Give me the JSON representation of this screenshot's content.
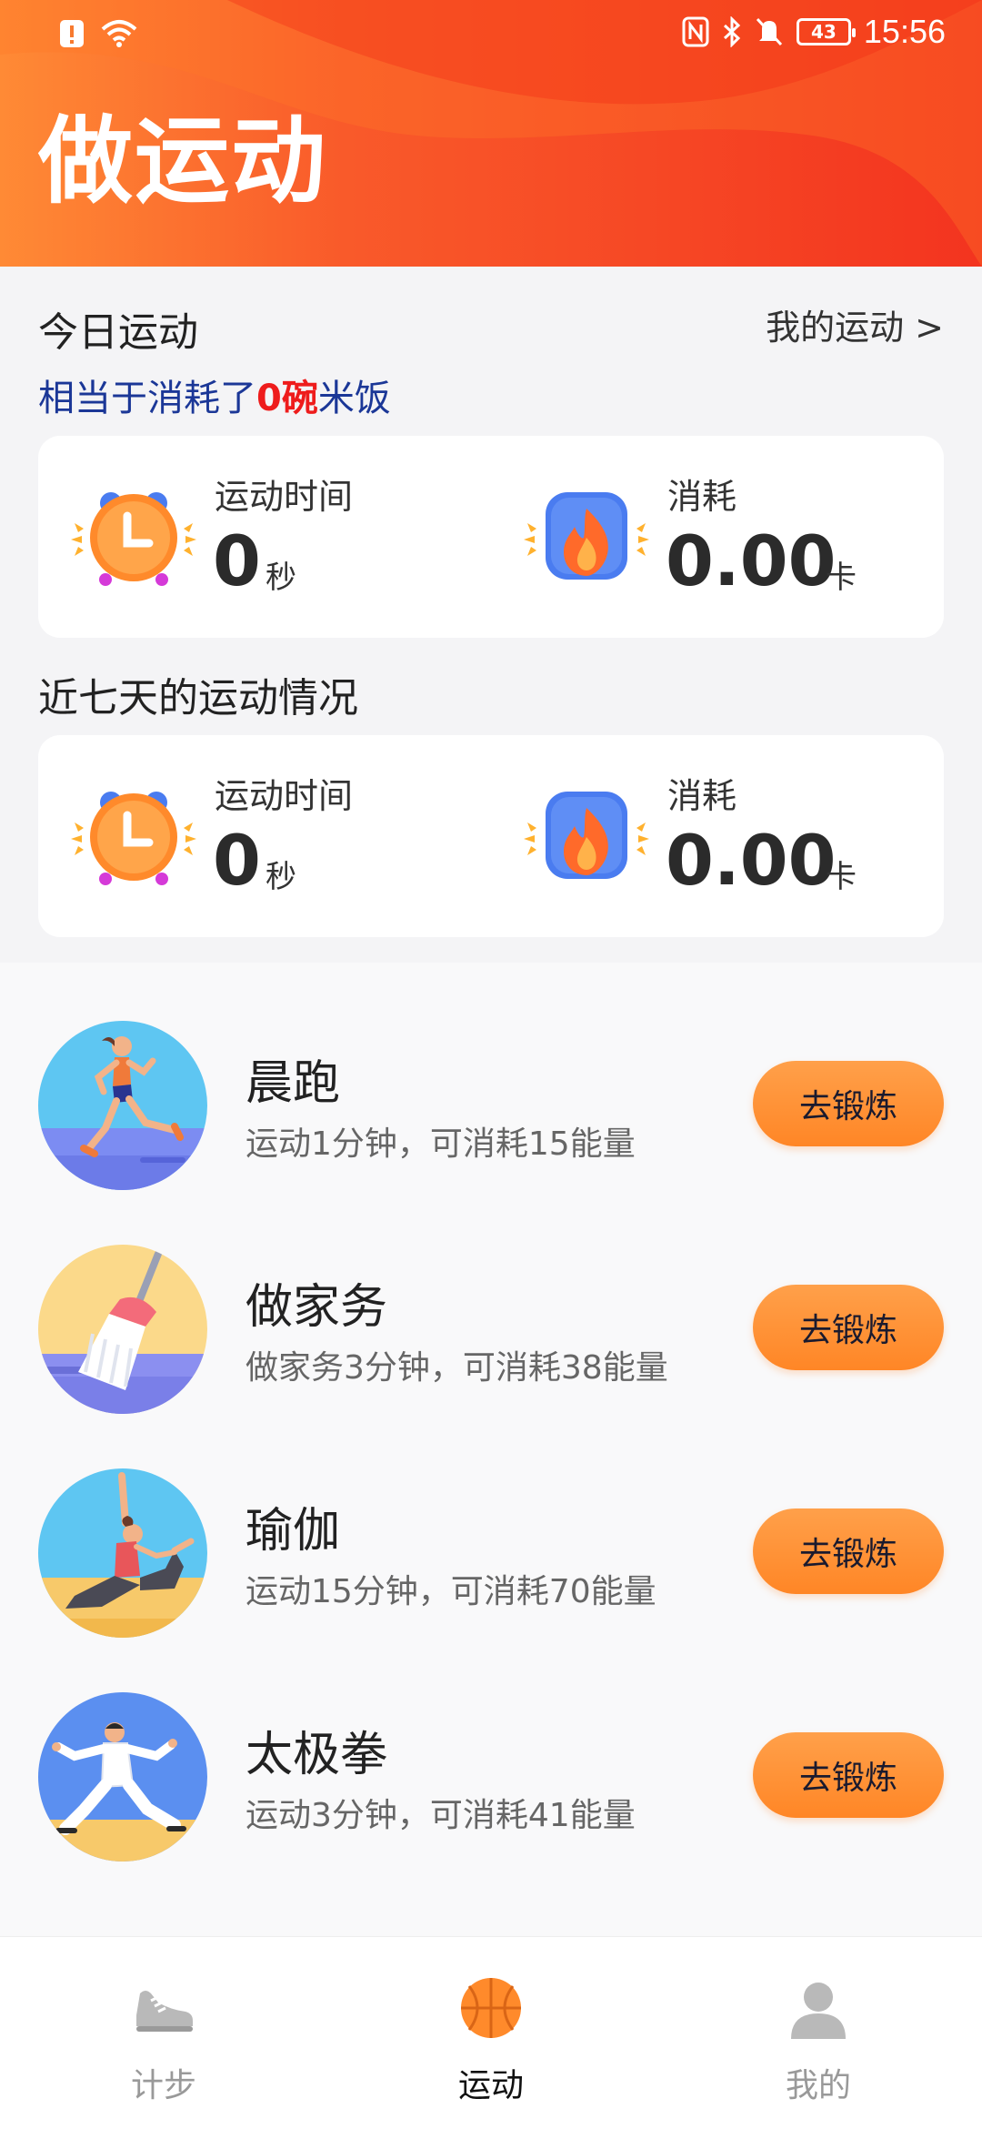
{
  "status_bar": {
    "time": "15:56",
    "battery": "43",
    "icons": [
      "alert-icon",
      "wifi-icon",
      "nfc-icon",
      "bluetooth-icon",
      "mute-icon",
      "battery-icon"
    ]
  },
  "header": {
    "title": "做运动"
  },
  "today": {
    "label": "今日运动",
    "my_sport_link": "我的运动 >",
    "rice_prefix": "相当于消耗了",
    "rice_count": "0碗",
    "rice_suffix": "米饭",
    "time_label": "运动时间",
    "time_value": "0",
    "time_unit": "秒",
    "cal_label": "消耗",
    "cal_value": "0.00",
    "cal_unit": "卡"
  },
  "week": {
    "label": "近七天的运动情况",
    "time_label": "运动时间",
    "time_value": "0",
    "time_unit": "秒",
    "cal_label": "消耗",
    "cal_value": "0.00",
    "cal_unit": "卡"
  },
  "exercises": [
    {
      "name": "晨跑",
      "desc": "运动1分钟，可消耗15能量",
      "button": "去锻炼",
      "icon": "running-icon"
    },
    {
      "name": "做家务",
      "desc": "做家务3分钟，可消耗38能量",
      "button": "去锻炼",
      "icon": "broom-icon"
    },
    {
      "name": "瑜伽",
      "desc": "运动15分钟，可消耗70能量",
      "button": "去锻炼",
      "icon": "yoga-icon"
    },
    {
      "name": "太极拳",
      "desc": "运动3分钟，可消耗41能量",
      "button": "去锻炼",
      "icon": "taichi-icon"
    }
  ],
  "nav": {
    "items": [
      {
        "label": "计步",
        "icon": "shoe-icon",
        "active": false
      },
      {
        "label": "运动",
        "icon": "basketball-icon",
        "active": true
      },
      {
        "label": "我的",
        "icon": "person-icon",
        "active": false
      }
    ]
  },
  "colors": {
    "header_start": "#ff8a35",
    "header_end": "#f3341f",
    "accent_orange": "#ff8c2e",
    "rice_blue": "#1b3797",
    "rice_red": "#ee1c1c"
  }
}
